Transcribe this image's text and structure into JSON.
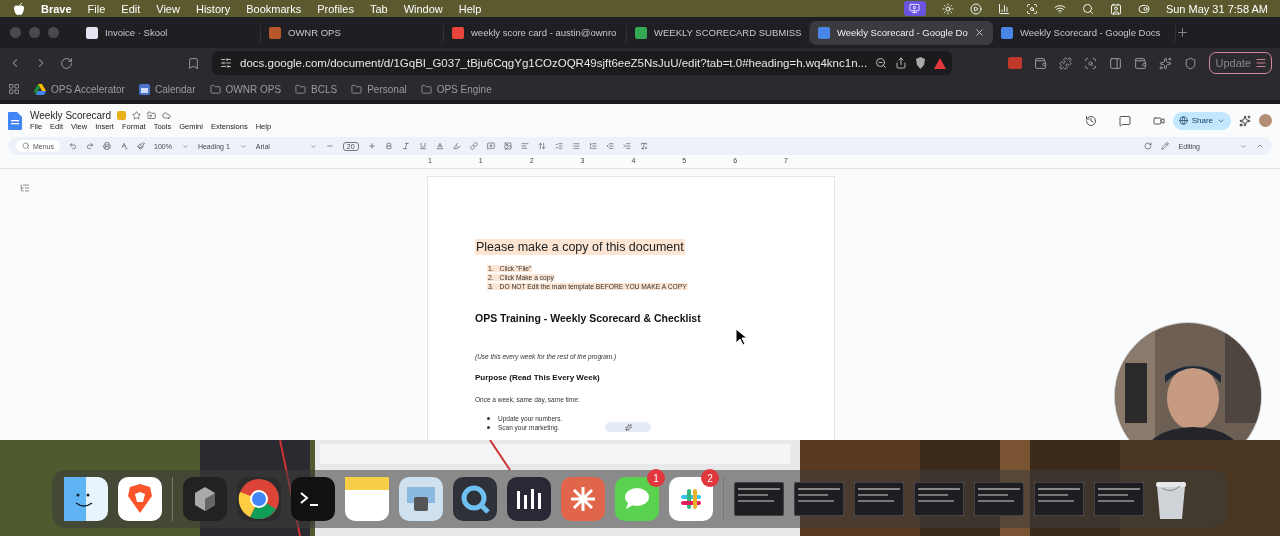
{
  "menubar": {
    "app": "Brave",
    "menus": [
      "File",
      "Edit",
      "View",
      "History",
      "Bookmarks",
      "Profiles",
      "Tab",
      "Window",
      "Help"
    ],
    "clock": "Sun May 31  7:58 AM"
  },
  "tabs": [
    {
      "title": "Invoice · Skool",
      "kind": "skool",
      "selected": false
    },
    {
      "title": "OWNR OPS",
      "kind": "ownr",
      "selected": false
    },
    {
      "title": "weekly score card - austin@ownro",
      "kind": "gmail",
      "selected": false
    },
    {
      "title": "WEEKLY SCORECARD SUBMISS",
      "kind": "sheets",
      "selected": false
    },
    {
      "title": "Weekly Scorecard - Google Do",
      "kind": "docs",
      "selected": true
    },
    {
      "title": "Weekly Scorecard - Google Docs",
      "kind": "docs",
      "selected": false
    }
  ],
  "address": {
    "url": "docs.google.com/document/d/1GqBI_G037_tBju6CqgYg1COzOQR49sjft6eeZ5NsJuU/edit?tab=t.0#heading=h.wq4knc1n..."
  },
  "update_button": "Update",
  "bookmarks": [
    {
      "label": "OPS Accelerator",
      "kind": "drive"
    },
    {
      "label": "Calendar",
      "kind": "calendar"
    },
    {
      "label": "OWNR OPS",
      "kind": "folder"
    },
    {
      "label": "BCLS",
      "kind": "folder"
    },
    {
      "label": "Personal",
      "kind": "folder"
    },
    {
      "label": "OPS Engine",
      "kind": "folder"
    }
  ],
  "docs": {
    "title": "Weekly Scorecard",
    "menus": [
      "File",
      "Edit",
      "View",
      "Insert",
      "Format",
      "Tools",
      "Gemini",
      "Extensions",
      "Help"
    ],
    "search_placeholder": "Menus",
    "zoom": "100%",
    "style": "Heading 1",
    "font": "Arial",
    "font_size": "20",
    "share": "Share",
    "mode": "Editing",
    "ruler": [
      "1",
      "1",
      "2",
      "3",
      "4",
      "5",
      "6",
      "7"
    ]
  },
  "document": {
    "heading": "Please make a copy of this document",
    "steps": [
      {
        "number": "1.",
        "text": "Click \"File\""
      },
      {
        "number": "2.",
        "text": "Click Make a copy"
      },
      {
        "number": "3.",
        "text": "DO NOT Edit the main template BEFORE YOU MAKE A COPY"
      }
    ],
    "title": "OPS Training - Weekly Scorecard & Checklist",
    "note": "(Use this every week for the rest of the program.)",
    "purpose": "Purpose (Read This Every Week)",
    "intro": "Once a week, same day, same time:",
    "bullets": [
      "Update your numbers.",
      "Scan your marketing."
    ]
  },
  "dock": [
    {
      "kind": "finder"
    },
    {
      "kind": "brave"
    },
    {
      "kind": "divider"
    },
    {
      "kind": "cube"
    },
    {
      "kind": "chrome"
    },
    {
      "kind": "terminal"
    },
    {
      "kind": "notes"
    },
    {
      "kind": "preview"
    },
    {
      "kind": "quicktime"
    },
    {
      "kind": "audio"
    },
    {
      "kind": "claude"
    },
    {
      "kind": "messages",
      "badge": "1"
    },
    {
      "kind": "slack",
      "badge": "2"
    },
    {
      "kind": "divider"
    },
    {
      "kind": "window"
    },
    {
      "kind": "window"
    },
    {
      "kind": "window"
    },
    {
      "kind": "window"
    },
    {
      "kind": "window"
    },
    {
      "kind": "window"
    },
    {
      "kind": "window"
    },
    {
      "kind": "trash"
    }
  ]
}
